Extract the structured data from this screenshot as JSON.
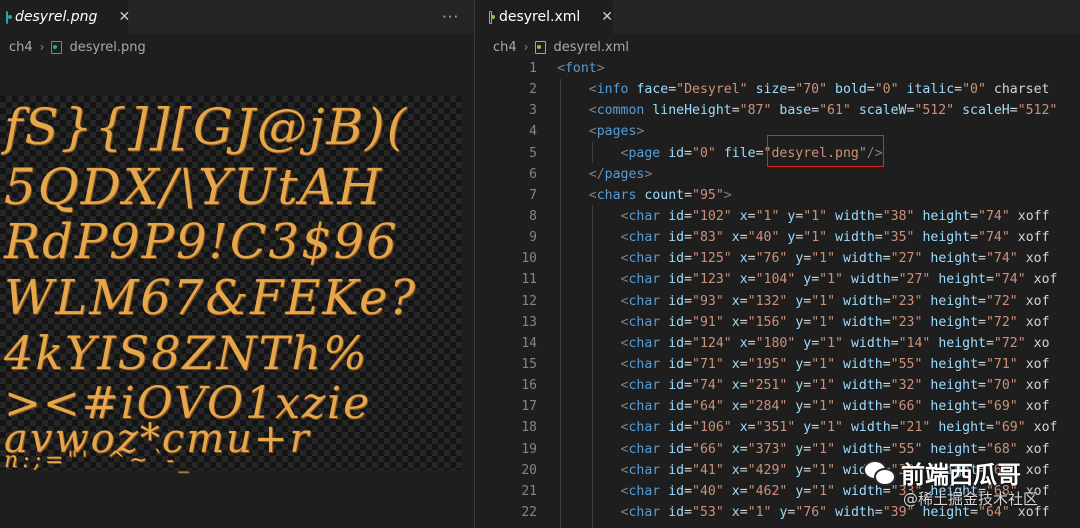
{
  "left_pane": {
    "tab_title": "desyrel.png",
    "close_icon": "close-icon",
    "more_icon": "ellipsis-icon",
    "breadcrumb": {
      "folder": "ch4",
      "file": "desyrel.png"
    },
    "atlas_rows": [
      "fS}{]][GJ@jB)(",
      "5QDX/\\YUtAH",
      "RdP9P9!C3$96",
      "WLM67&FEKe?",
      "4kYIS8ZNTh%",
      "><#iOVO1xzie",
      "avwoz*cmu+r",
      "n:;=\"'`^~`-_"
    ]
  },
  "right_pane": {
    "tab_title": "desyrel.xml",
    "close_icon": "close-icon",
    "breadcrumb": {
      "folder": "ch4",
      "file": "desyrel.xml"
    },
    "line_numbers": [
      "1",
      "2",
      "3",
      "4",
      "5",
      "6",
      "7",
      "8",
      "9",
      "10",
      "11",
      "12",
      "13",
      "14",
      "15",
      "16",
      "17",
      "18",
      "19",
      "20",
      "21",
      "22"
    ],
    "code_lines": [
      "<font>",
      "    <info face=\"Desyrel\" size=\"70\" bold=\"0\" italic=\"0\" charset",
      "    <common lineHeight=\"87\" base=\"61\" scaleW=\"512\" scaleH=\"512\"",
      "    <pages>",
      "        <page id=\"0\" file=\"desyrel.png\"/>",
      "    </pages>",
      "    <chars count=\"95\">",
      "        <char id=\"102\" x=\"1\" y=\"1\" width=\"38\" height=\"74\" xoff",
      "        <char id=\"83\" x=\"40\" y=\"1\" width=\"35\" height=\"74\" xoff",
      "        <char id=\"125\" x=\"76\" y=\"1\" width=\"27\" height=\"74\" xof",
      "        <char id=\"123\" x=\"104\" y=\"1\" width=\"27\" height=\"74\" xof",
      "        <char id=\"93\" x=\"132\" y=\"1\" width=\"23\" height=\"72\" xof",
      "        <char id=\"91\" x=\"156\" y=\"1\" width=\"23\" height=\"72\" xof",
      "        <char id=\"124\" x=\"180\" y=\"1\" width=\"14\" height=\"72\" xo",
      "        <char id=\"71\" x=\"195\" y=\"1\" width=\"55\" height=\"71\" xof",
      "        <char id=\"74\" x=\"251\" y=\"1\" width=\"32\" height=\"70\" xof",
      "        <char id=\"64\" x=\"284\" y=\"1\" width=\"66\" height=\"69\" xof",
      "        <char id=\"106\" x=\"351\" y=\"1\" width=\"21\" height=\"69\" xof",
      "        <char id=\"66\" x=\"373\" y=\"1\" width=\"55\" height=\"68\" xof",
      "        <char id=\"41\" x=\"429\" y=\"1\" width=\"32\" height=\"68\" xof",
      "        <char id=\"40\" x=\"462\" y=\"1\" width=\"33\" height=\"68\" xof",
      "        <char id=\"53\" x=\"1\" y=\"76\" width=\"39\" height=\"64\" xoff"
    ]
  },
  "watermark": {
    "title": "前端西瓜哥",
    "subtitle": "@稀土掘金技术社区"
  },
  "colors": {
    "glyph": "#e6a64a",
    "tag": "#569cd6",
    "attr": "#9cdcfe",
    "value": "#ce9178",
    "highlight_box": "#e02424"
  }
}
